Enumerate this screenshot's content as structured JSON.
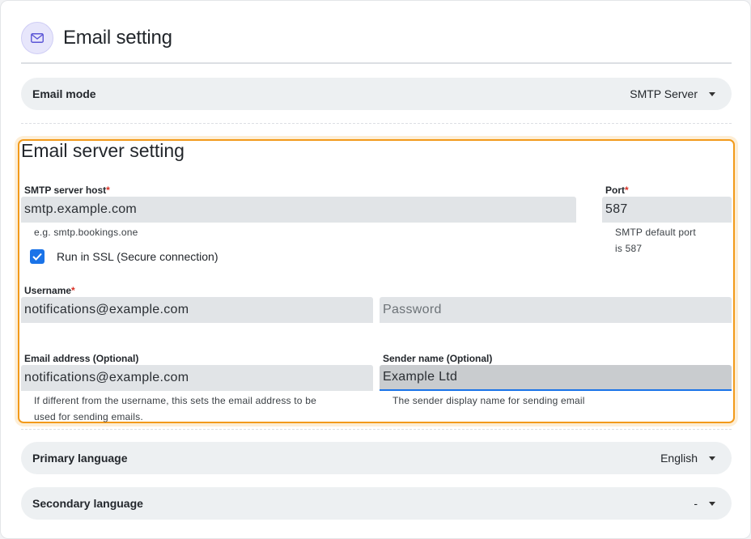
{
  "header": {
    "title": "Email setting",
    "icon": "mail-icon"
  },
  "email_mode": {
    "label": "Email mode",
    "value": "SMTP Server"
  },
  "server": {
    "title": "Email server setting",
    "host": {
      "label": "SMTP server host",
      "required": "*",
      "value": "smtp.example.com",
      "helper": "e.g. smtp.bookings.one"
    },
    "port": {
      "label": "Port",
      "required": "*",
      "value": "587",
      "helper_line1": "SMTP default port",
      "helper_line2": "is 587"
    },
    "ssl": {
      "label": "Run in SSL (Secure connection)",
      "checked": true
    },
    "username": {
      "label": "Username",
      "required": "*",
      "value": "notifications@example.com"
    },
    "password": {
      "placeholder": "Password",
      "value": ""
    },
    "email_address": {
      "label": "Email address (Optional)",
      "value": "notifications@example.com",
      "helper_line1": "If different from the username, this sets the email address to be",
      "helper_line2": "used for sending emails."
    },
    "sender_name": {
      "label": "Sender name (Optional)",
      "value": "Example Ltd",
      "helper": "The sender display name for sending email"
    }
  },
  "primary_language": {
    "label": "Primary language",
    "value": "English"
  },
  "secondary_language": {
    "label": "Secondary language",
    "value": "-"
  },
  "colors": {
    "highlight": "#f29a1a",
    "accent": "#1a73e8",
    "icon_bg": "#e7e6fb",
    "icon_stroke": "#5b55d6"
  }
}
